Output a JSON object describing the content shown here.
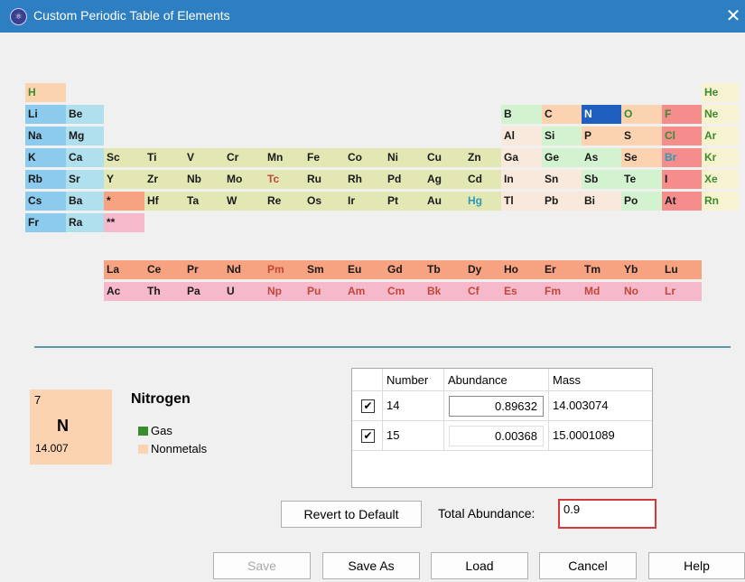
{
  "window": {
    "title": "Custom Periodic Table of Elements",
    "close_glyph": "✕"
  },
  "colors": {
    "alkali": "#8ccbee",
    "alkaline": "#b0dfee",
    "transition": "#e3e7b3",
    "post_transition": "#f8e9dc",
    "metalloid": "#d2f2d0",
    "nonmetal": "#fbd3b0",
    "halogen": "#f58d8d",
    "noble": "#f7f2d0",
    "lanthanide": "#f7a280",
    "actinide": "#f6b8cb",
    "selected": "#1f5fbf",
    "text_solid": "#1a1a1a",
    "text_liquid": "#2b9bb6",
    "text_gas": "#3a8d2e",
    "text_synthetic": "#c0483b"
  },
  "elements": [
    {
      "s": "H",
      "r": 0,
      "c": 0,
      "cat": "nonmetal",
      "st": "gas"
    },
    {
      "s": "He",
      "r": 0,
      "c": 17,
      "cat": "noble",
      "st": "gas"
    },
    {
      "s": "Li",
      "r": 1,
      "c": 0,
      "cat": "alkali",
      "st": "solid"
    },
    {
      "s": "Be",
      "r": 1,
      "c": 1,
      "cat": "alkaline",
      "st": "solid"
    },
    {
      "s": "B",
      "r": 1,
      "c": 12,
      "cat": "metalloid",
      "st": "solid"
    },
    {
      "s": "C",
      "r": 1,
      "c": 13,
      "cat": "nonmetal",
      "st": "solid"
    },
    {
      "s": "N",
      "r": 1,
      "c": 14,
      "cat": "selected",
      "st": "selected"
    },
    {
      "s": "O",
      "r": 1,
      "c": 15,
      "cat": "nonmetal",
      "st": "gas"
    },
    {
      "s": "F",
      "r": 1,
      "c": 16,
      "cat": "halogen",
      "st": "gas"
    },
    {
      "s": "Ne",
      "r": 1,
      "c": 17,
      "cat": "noble",
      "st": "gas"
    },
    {
      "s": "Na",
      "r": 2,
      "c": 0,
      "cat": "alkali",
      "st": "solid"
    },
    {
      "s": "Mg",
      "r": 2,
      "c": 1,
      "cat": "alkaline",
      "st": "solid"
    },
    {
      "s": "Al",
      "r": 2,
      "c": 12,
      "cat": "post_transition",
      "st": "solid"
    },
    {
      "s": "Si",
      "r": 2,
      "c": 13,
      "cat": "metalloid",
      "st": "solid"
    },
    {
      "s": "P",
      "r": 2,
      "c": 14,
      "cat": "nonmetal",
      "st": "solid"
    },
    {
      "s": "S",
      "r": 2,
      "c": 15,
      "cat": "nonmetal",
      "st": "solid"
    },
    {
      "s": "Cl",
      "r": 2,
      "c": 16,
      "cat": "halogen",
      "st": "gas"
    },
    {
      "s": "Ar",
      "r": 2,
      "c": 17,
      "cat": "noble",
      "st": "gas"
    },
    {
      "s": "K",
      "r": 3,
      "c": 0,
      "cat": "alkali",
      "st": "solid"
    },
    {
      "s": "Ca",
      "r": 3,
      "c": 1,
      "cat": "alkaline",
      "st": "solid"
    },
    {
      "s": "Sc",
      "r": 3,
      "c": 2,
      "cat": "transition",
      "st": "solid"
    },
    {
      "s": "Ti",
      "r": 3,
      "c": 3,
      "cat": "transition",
      "st": "solid"
    },
    {
      "s": "V",
      "r": 3,
      "c": 4,
      "cat": "transition",
      "st": "solid"
    },
    {
      "s": "Cr",
      "r": 3,
      "c": 5,
      "cat": "transition",
      "st": "solid"
    },
    {
      "s": "Mn",
      "r": 3,
      "c": 6,
      "cat": "transition",
      "st": "solid"
    },
    {
      "s": "Fe",
      "r": 3,
      "c": 7,
      "cat": "transition",
      "st": "solid"
    },
    {
      "s": "Co",
      "r": 3,
      "c": 8,
      "cat": "transition",
      "st": "solid"
    },
    {
      "s": "Ni",
      "r": 3,
      "c": 9,
      "cat": "transition",
      "st": "solid"
    },
    {
      "s": "Cu",
      "r": 3,
      "c": 10,
      "cat": "transition",
      "st": "solid"
    },
    {
      "s": "Zn",
      "r": 3,
      "c": 11,
      "cat": "transition",
      "st": "solid"
    },
    {
      "s": "Ga",
      "r": 3,
      "c": 12,
      "cat": "post_transition",
      "st": "solid"
    },
    {
      "s": "Ge",
      "r": 3,
      "c": 13,
      "cat": "metalloid",
      "st": "solid"
    },
    {
      "s": "As",
      "r": 3,
      "c": 14,
      "cat": "metalloid",
      "st": "solid"
    },
    {
      "s": "Se",
      "r": 3,
      "c": 15,
      "cat": "nonmetal",
      "st": "solid"
    },
    {
      "s": "Br",
      "r": 3,
      "c": 16,
      "cat": "halogen",
      "st": "liquid"
    },
    {
      "s": "Kr",
      "r": 3,
      "c": 17,
      "cat": "noble",
      "st": "gas"
    },
    {
      "s": "Rb",
      "r": 4,
      "c": 0,
      "cat": "alkali",
      "st": "solid"
    },
    {
      "s": "Sr",
      "r": 4,
      "c": 1,
      "cat": "alkaline",
      "st": "solid"
    },
    {
      "s": "Y",
      "r": 4,
      "c": 2,
      "cat": "transition",
      "st": "solid"
    },
    {
      "s": "Zr",
      "r": 4,
      "c": 3,
      "cat": "transition",
      "st": "solid"
    },
    {
      "s": "Nb",
      "r": 4,
      "c": 4,
      "cat": "transition",
      "st": "solid"
    },
    {
      "s": "Mo",
      "r": 4,
      "c": 5,
      "cat": "transition",
      "st": "solid"
    },
    {
      "s": "Tc",
      "r": 4,
      "c": 6,
      "cat": "transition",
      "st": "synthetic"
    },
    {
      "s": "Ru",
      "r": 4,
      "c": 7,
      "cat": "transition",
      "st": "solid"
    },
    {
      "s": "Rh",
      "r": 4,
      "c": 8,
      "cat": "transition",
      "st": "solid"
    },
    {
      "s": "Pd",
      "r": 4,
      "c": 9,
      "cat": "transition",
      "st": "solid"
    },
    {
      "s": "Ag",
      "r": 4,
      "c": 10,
      "cat": "transition",
      "st": "solid"
    },
    {
      "s": "Cd",
      "r": 4,
      "c": 11,
      "cat": "transition",
      "st": "solid"
    },
    {
      "s": "In",
      "r": 4,
      "c": 12,
      "cat": "post_transition",
      "st": "solid"
    },
    {
      "s": "Sn",
      "r": 4,
      "c": 13,
      "cat": "post_transition",
      "st": "solid"
    },
    {
      "s": "Sb",
      "r": 4,
      "c": 14,
      "cat": "metalloid",
      "st": "solid"
    },
    {
      "s": "Te",
      "r": 4,
      "c": 15,
      "cat": "metalloid",
      "st": "solid"
    },
    {
      "s": "I",
      "r": 4,
      "c": 16,
      "cat": "halogen",
      "st": "solid"
    },
    {
      "s": "Xe",
      "r": 4,
      "c": 17,
      "cat": "noble",
      "st": "gas"
    },
    {
      "s": "Cs",
      "r": 5,
      "c": 0,
      "cat": "alkali",
      "st": "solid"
    },
    {
      "s": "Ba",
      "r": 5,
      "c": 1,
      "cat": "alkaline",
      "st": "solid"
    },
    {
      "s": "*",
      "r": 5,
      "c": 2,
      "cat": "lanthanide",
      "st": "solid"
    },
    {
      "s": "Hf",
      "r": 5,
      "c": 3,
      "cat": "transition",
      "st": "solid"
    },
    {
      "s": "Ta",
      "r": 5,
      "c": 4,
      "cat": "transition",
      "st": "solid"
    },
    {
      "s": "W",
      "r": 5,
      "c": 5,
      "cat": "transition",
      "st": "solid"
    },
    {
      "s": "Re",
      "r": 5,
      "c": 6,
      "cat": "transition",
      "st": "solid"
    },
    {
      "s": "Os",
      "r": 5,
      "c": 7,
      "cat": "transition",
      "st": "solid"
    },
    {
      "s": "Ir",
      "r": 5,
      "c": 8,
      "cat": "transition",
      "st": "solid"
    },
    {
      "s": "Pt",
      "r": 5,
      "c": 9,
      "cat": "transition",
      "st": "solid"
    },
    {
      "s": "Au",
      "r": 5,
      "c": 10,
      "cat": "transition",
      "st": "solid"
    },
    {
      "s": "Hg",
      "r": 5,
      "c": 11,
      "cat": "transition",
      "st": "liquid"
    },
    {
      "s": "Tl",
      "r": 5,
      "c": 12,
      "cat": "post_transition",
      "st": "solid"
    },
    {
      "s": "Pb",
      "r": 5,
      "c": 13,
      "cat": "post_transition",
      "st": "solid"
    },
    {
      "s": "Bi",
      "r": 5,
      "c": 14,
      "cat": "post_transition",
      "st": "solid"
    },
    {
      "s": "Po",
      "r": 5,
      "c": 15,
      "cat": "metalloid",
      "st": "solid"
    },
    {
      "s": "At",
      "r": 5,
      "c": 16,
      "cat": "halogen",
      "st": "solid"
    },
    {
      "s": "Rn",
      "r": 5,
      "c": 17,
      "cat": "noble",
      "st": "gas"
    },
    {
      "s": "Fr",
      "r": 6,
      "c": 0,
      "cat": "alkali",
      "st": "solid"
    },
    {
      "s": "Ra",
      "r": 6,
      "c": 1,
      "cat": "alkaline",
      "st": "solid"
    },
    {
      "s": "**",
      "r": 6,
      "c": 2,
      "cat": "actinide",
      "st": "solid"
    },
    {
      "s": "La",
      "r": 7,
      "c": 2,
      "cat": "lanthanide",
      "st": "solid"
    },
    {
      "s": "Ce",
      "r": 7,
      "c": 3,
      "cat": "lanthanide",
      "st": "solid"
    },
    {
      "s": "Pr",
      "r": 7,
      "c": 4,
      "cat": "lanthanide",
      "st": "solid"
    },
    {
      "s": "Nd",
      "r": 7,
      "c": 5,
      "cat": "lanthanide",
      "st": "solid"
    },
    {
      "s": "Pm",
      "r": 7,
      "c": 6,
      "cat": "lanthanide",
      "st": "synthetic"
    },
    {
      "s": "Sm",
      "r": 7,
      "c": 7,
      "cat": "lanthanide",
      "st": "solid"
    },
    {
      "s": "Eu",
      "r": 7,
      "c": 8,
      "cat": "lanthanide",
      "st": "solid"
    },
    {
      "s": "Gd",
      "r": 7,
      "c": 9,
      "cat": "lanthanide",
      "st": "solid"
    },
    {
      "s": "Tb",
      "r": 7,
      "c": 10,
      "cat": "lanthanide",
      "st": "solid"
    },
    {
      "s": "Dy",
      "r": 7,
      "c": 11,
      "cat": "lanthanide",
      "st": "solid"
    },
    {
      "s": "Ho",
      "r": 7,
      "c": 12,
      "cat": "lanthanide",
      "st": "solid"
    },
    {
      "s": "Er",
      "r": 7,
      "c": 13,
      "cat": "lanthanide",
      "st": "solid"
    },
    {
      "s": "Tm",
      "r": 7,
      "c": 14,
      "cat": "lanthanide",
      "st": "solid"
    },
    {
      "s": "Yb",
      "r": 7,
      "c": 15,
      "cat": "lanthanide",
      "st": "solid"
    },
    {
      "s": "Lu",
      "r": 7,
      "c": 16,
      "cat": "lanthanide",
      "st": "solid"
    },
    {
      "s": "Ac",
      "r": 8,
      "c": 2,
      "cat": "actinide",
      "st": "solid"
    },
    {
      "s": "Th",
      "r": 8,
      "c": 3,
      "cat": "actinide",
      "st": "solid"
    },
    {
      "s": "Pa",
      "r": 8,
      "c": 4,
      "cat": "actinide",
      "st": "solid"
    },
    {
      "s": "U",
      "r": 8,
      "c": 5,
      "cat": "actinide",
      "st": "solid"
    },
    {
      "s": "Np",
      "r": 8,
      "c": 6,
      "cat": "actinide",
      "st": "synthetic"
    },
    {
      "s": "Pu",
      "r": 8,
      "c": 7,
      "cat": "actinide",
      "st": "synthetic"
    },
    {
      "s": "Am",
      "r": 8,
      "c": 8,
      "cat": "actinide",
      "st": "synthetic"
    },
    {
      "s": "Cm",
      "r": 8,
      "c": 9,
      "cat": "actinide",
      "st": "synthetic"
    },
    {
      "s": "Bk",
      "r": 8,
      "c": 10,
      "cat": "actinide",
      "st": "synthetic"
    },
    {
      "s": "Cf",
      "r": 8,
      "c": 11,
      "cat": "actinide",
      "st": "synthetic"
    },
    {
      "s": "Es",
      "r": 8,
      "c": 12,
      "cat": "actinide",
      "st": "synthetic"
    },
    {
      "s": "Fm",
      "r": 8,
      "c": 13,
      "cat": "actinide",
      "st": "synthetic"
    },
    {
      "s": "Md",
      "r": 8,
      "c": 14,
      "cat": "actinide",
      "st": "synthetic"
    },
    {
      "s": "No",
      "r": 8,
      "c": 15,
      "cat": "actinide",
      "st": "synthetic"
    },
    {
      "s": "Lr",
      "r": 8,
      "c": 16,
      "cat": "actinide",
      "st": "synthetic"
    }
  ],
  "selected": {
    "number": "7",
    "symbol": "N",
    "mass": "14.007",
    "name": "Nitrogen",
    "state": "Gas",
    "category": "Nonmetals",
    "state_color": "#3a8d2e",
    "category_color": "#fbd3b0"
  },
  "isotopes": {
    "headers": [
      "Number",
      "Abundance",
      "Mass"
    ],
    "rows": [
      {
        "checked": true,
        "number": "14",
        "abundance": "0.89632",
        "mass": "14.003074"
      },
      {
        "checked": true,
        "number": "15",
        "abundance": "0.00368",
        "mass": "15.0001089"
      }
    ]
  },
  "controls": {
    "revert_label": "Revert to Default",
    "total_label": "Total Abundance:",
    "total_value": "0.9"
  },
  "buttons": {
    "save": "Save",
    "save_as": "Save As",
    "load": "Load",
    "cancel": "Cancel",
    "help": "Help"
  }
}
